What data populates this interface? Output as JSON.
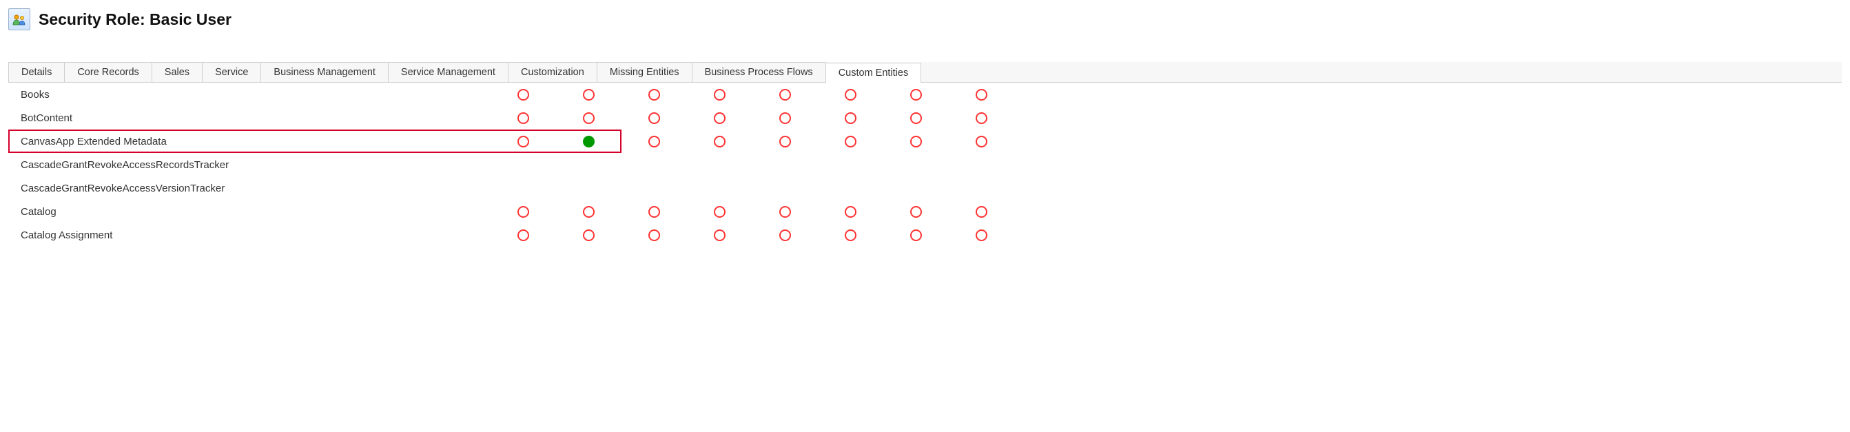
{
  "header": {
    "title": "Security Role: Basic User"
  },
  "tabs": [
    {
      "label": "Details",
      "active": false
    },
    {
      "label": "Core Records",
      "active": false
    },
    {
      "label": "Sales",
      "active": false
    },
    {
      "label": "Service",
      "active": false
    },
    {
      "label": "Business Management",
      "active": false
    },
    {
      "label": "Service Management",
      "active": false
    },
    {
      "label": "Customization",
      "active": false
    },
    {
      "label": "Missing Entities",
      "active": false
    },
    {
      "label": "Business Process Flows",
      "active": false
    },
    {
      "label": "Custom Entities",
      "active": true
    }
  ],
  "entities": [
    {
      "name": "Books",
      "highlight": false,
      "perms": [
        "none",
        "none",
        "none",
        "none",
        "none",
        "none",
        "none",
        "none"
      ]
    },
    {
      "name": "BotContent",
      "highlight": false,
      "perms": [
        "none",
        "none",
        "none",
        "none",
        "none",
        "none",
        "none",
        "none"
      ]
    },
    {
      "name": "CanvasApp Extended Metadata",
      "highlight": true,
      "perms": [
        "none",
        "full",
        "none",
        "none",
        "none",
        "none",
        "none",
        "none"
      ]
    },
    {
      "name": "CascadeGrantRevokeAccessRecordsTracker",
      "highlight": false,
      "perms": []
    },
    {
      "name": "CascadeGrantRevokeAccessVersionTracker",
      "highlight": false,
      "perms": []
    },
    {
      "name": "Catalog",
      "highlight": false,
      "perms": [
        "none",
        "none",
        "none",
        "none",
        "none",
        "none",
        "none",
        "none"
      ]
    },
    {
      "name": "Catalog Assignment",
      "highlight": false,
      "perms": [
        "none",
        "none",
        "none",
        "none",
        "none",
        "none",
        "none",
        "none"
      ]
    }
  ],
  "perm_count": 8
}
